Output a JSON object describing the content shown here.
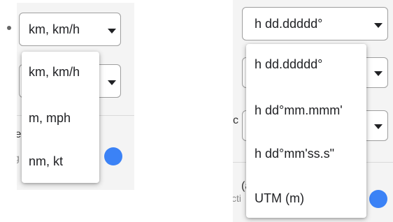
{
  "left": {
    "select": {
      "value": "km, km/h"
    },
    "menu": {
      "items": [
        "km, km/h",
        "m, mph",
        "nm, kt"
      ]
    },
    "fragments": {
      "a": "le",
      "b": "g"
    },
    "toggle_color": "#3b82f6"
  },
  "right": {
    "select": {
      "value": "h dd.ddddd°"
    },
    "menu": {
      "items": [
        "h dd.ddddd°",
        "h dd°mm.mmm'",
        "h dd°mm'ss.s\"",
        "UTM (m)"
      ]
    },
    "fragments": {
      "a": "c",
      "b": "(a",
      "c": "cti"
    },
    "toggle_color": "#3b82f6"
  },
  "icons": {
    "dropdown": "caret-down-icon"
  }
}
